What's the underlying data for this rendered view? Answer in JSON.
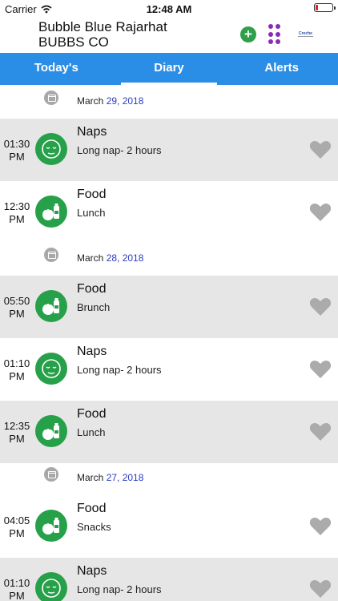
{
  "status": {
    "carrier": "Carrier",
    "time": "12:48 AM"
  },
  "header": {
    "school_name": "Bubble Blue Rajarhat BUBBS CO",
    "logo_text": "Creche"
  },
  "tabs": [
    {
      "label": "Today's",
      "active": false
    },
    {
      "label": "Diary",
      "active": true
    },
    {
      "label": "Alerts",
      "active": false
    }
  ],
  "colors": {
    "accent": "#2b8ee6",
    "green": "#27a04a",
    "purple": "#8a2bb5",
    "date_day": "#2a3bc0",
    "shaded_row": "#e6e6e6"
  },
  "groups": [
    {
      "month": "March",
      "day": "29, 2018",
      "entries": [
        {
          "time_line1": "01:30",
          "time_line2": "PM",
          "title": "Naps",
          "subtitle": "Long nap- 2 hours",
          "icon": "sleep-face-icon"
        },
        {
          "time_line1": "12:30",
          "time_line2": "PM",
          "title": "Food",
          "subtitle": "Lunch",
          "icon": "food-icon"
        }
      ]
    },
    {
      "month": "March",
      "day": "28, 2018",
      "entries": [
        {
          "time_line1": "05:50",
          "time_line2": "PM",
          "title": "Food",
          "subtitle": "Brunch",
          "icon": "food-icon"
        },
        {
          "time_line1": "01:10",
          "time_line2": "PM",
          "title": "Naps",
          "subtitle": "Long nap- 2 hours",
          "icon": "sleep-face-icon"
        },
        {
          "time_line1": "12:35",
          "time_line2": "PM",
          "title": "Food",
          "subtitle": "Lunch",
          "icon": "food-icon"
        }
      ]
    },
    {
      "month": "March",
      "day": "27, 2018",
      "entries": [
        {
          "time_line1": "04:05",
          "time_line2": "PM",
          "title": "Food",
          "subtitle": "Snacks",
          "icon": "food-icon"
        },
        {
          "time_line1": "01:10",
          "time_line2": "PM",
          "title": "Naps",
          "subtitle": "Long nap- 2 hours",
          "icon": "sleep-face-icon"
        }
      ]
    }
  ]
}
